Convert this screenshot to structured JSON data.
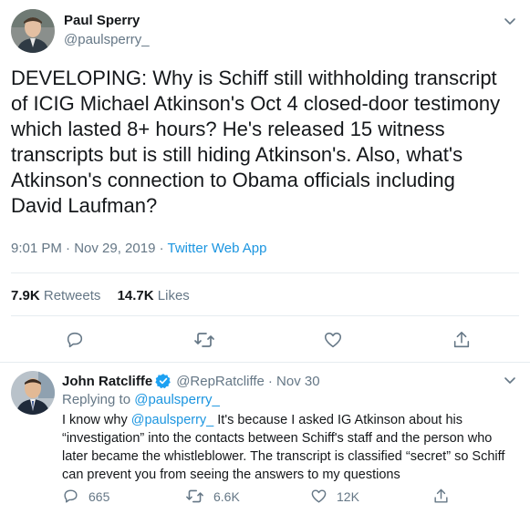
{
  "main_tweet": {
    "author_name": "Paul Sperry",
    "author_handle": "@paulsperry_",
    "text_lines": [
      "DEVELOPING: Why is Schiff still withholding transcript",
      "of ICIG Michael Atkinson's Oct 4 closed-door testimony",
      "which lasted 8+ hours? He's released 15 witness",
      "transcripts but is still hiding Atkinson's. Also, what's",
      "Atkinson's connection to Obama officials including",
      "David Laufman?"
    ],
    "timestamp": "9:01 PM · Nov 29, 2019",
    "separator": "·",
    "source": "Twitter Web App",
    "retweets_count": "7.9K",
    "retweets_label": "Retweets",
    "likes_count": "14.7K",
    "likes_label": "Likes"
  },
  "reply_tweet": {
    "author_name": "John Ratcliffe",
    "author_handle": "@RepRatcliffe",
    "date": "· Nov 30",
    "replying_to_label": "Replying to",
    "replying_to_handle": "@paulsperry_",
    "line1_prefix": "I know why ",
    "line1_mention": "@paulsperry_",
    "line1_suffix": " It's because I asked IG Atkinson about his",
    "lines": [
      "“investigation” into the contacts between Schiff's staff and the person who",
      "later became the whistleblower. The transcript is classified “secret” so Schiff",
      "can prevent you from seeing the answers to my questions"
    ],
    "reply_count": "665",
    "retweet_count": "6.6K",
    "like_count": "12K"
  },
  "icons": {
    "chevron": "chevron-down-icon",
    "reply": "reply-icon",
    "retweet": "retweet-icon",
    "like": "heart-icon",
    "share": "share-icon",
    "verified": "verified-badge-icon"
  },
  "colors": {
    "link": "#1b95e0",
    "verified": "#1da1f2",
    "muted": "#657786",
    "text": "#14171a"
  }
}
